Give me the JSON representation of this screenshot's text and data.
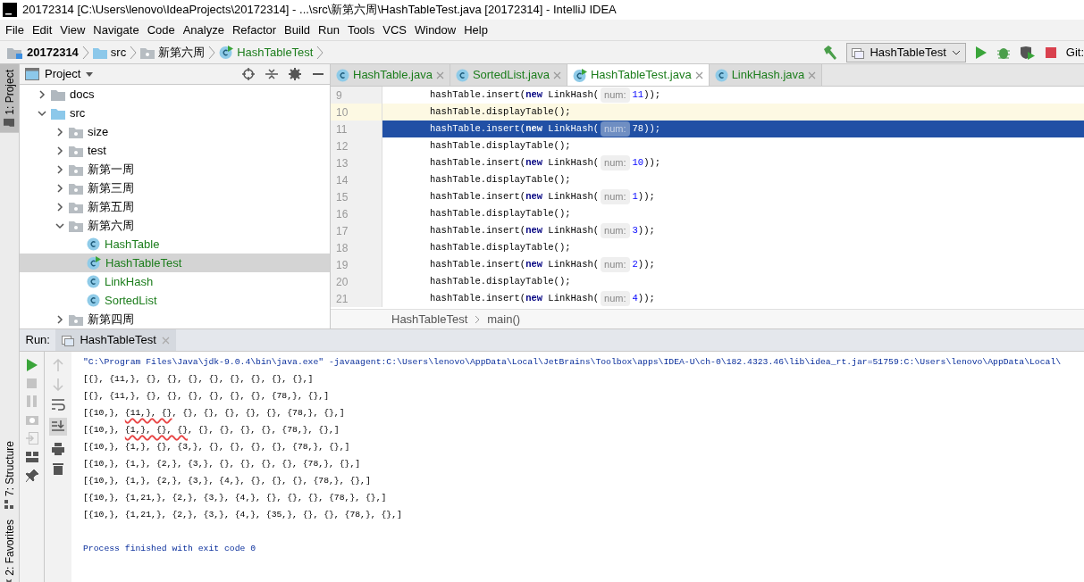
{
  "window": {
    "title": "20172314 [C:\\Users\\lenovo\\IdeaProjects\\20172314] - ...\\src\\新第六周\\HashTableTest.java [20172314] - IntelliJ IDEA"
  },
  "menu": [
    "File",
    "Edit",
    "View",
    "Navigate",
    "Code",
    "Analyze",
    "Refactor",
    "Build",
    "Run",
    "Tools",
    "VCS",
    "Window",
    "Help"
  ],
  "breadcrumbs": [
    {
      "label": "20172314",
      "kind": "project"
    },
    {
      "label": "src",
      "kind": "source_root"
    },
    {
      "label": "新第六周",
      "kind": "package"
    },
    {
      "label": "HashTableTest",
      "kind": "main_class"
    }
  ],
  "toolbar": {
    "run_config": "HashTableTest",
    "vcs_label": "Git:"
  },
  "side_tools": [
    {
      "label": "1: Project",
      "selected": true
    },
    {
      "label": "7: Structure",
      "selected": false
    },
    {
      "label": "2: Favorites",
      "selected": false
    }
  ],
  "project_panel": {
    "title": "Project",
    "tree": [
      {
        "label": "docs",
        "kind": "folder",
        "expanded": false,
        "selected": false
      },
      {
        "label": "src",
        "kind": "source_root",
        "expanded": true,
        "selected": false,
        "children": [
          {
            "label": "size",
            "kind": "package",
            "expanded": false,
            "selected": false
          },
          {
            "label": "test",
            "kind": "package",
            "expanded": false,
            "selected": false
          },
          {
            "label": "新第一周",
            "kind": "package",
            "expanded": false,
            "selected": false
          },
          {
            "label": "新第三周",
            "kind": "package",
            "expanded": false,
            "selected": false
          },
          {
            "label": "新第五周",
            "kind": "package",
            "expanded": false,
            "selected": false
          },
          {
            "label": "新第六周",
            "kind": "package",
            "expanded": true,
            "selected": false,
            "children": [
              {
                "label": "HashTable",
                "kind": "class",
                "selected": false
              },
              {
                "label": "HashTableTest",
                "kind": "main_class",
                "selected": true
              },
              {
                "label": "LinkHash",
                "kind": "class",
                "selected": false
              },
              {
                "label": "SortedList",
                "kind": "class",
                "selected": false
              }
            ]
          },
          {
            "label": "新第四周",
            "kind": "package",
            "expanded": false,
            "selected": false
          }
        ]
      }
    ]
  },
  "editor_tabs": [
    {
      "label": "HashTable.java",
      "kind": "class",
      "selected": false
    },
    {
      "label": "SortedList.java",
      "kind": "class",
      "selected": false
    },
    {
      "label": "HashTableTest.java",
      "kind": "main_class",
      "selected": true
    },
    {
      "label": "LinkHash.java",
      "kind": "class",
      "selected": false
    }
  ],
  "code_lines": [
    {
      "number": "9",
      "caret": false,
      "selected": false,
      "tokens": [
        {
          "kind": "plain",
          "text": "hashTable.insert("
        },
        {
          "kind": "keyword",
          "text": "new"
        },
        {
          "kind": "plain",
          "text": " LinkHash("
        },
        {
          "kind": "hint",
          "text": "num:"
        },
        {
          "kind": "number",
          "text": "11"
        },
        {
          "kind": "plain",
          "text": "));"
        }
      ]
    },
    {
      "number": "10",
      "caret": true,
      "selected": false,
      "tokens": [
        {
          "kind": "plain",
          "text": "hashTable.displayTable();"
        }
      ]
    },
    {
      "number": "11",
      "caret": false,
      "selected": true,
      "tokens": [
        {
          "kind": "plain",
          "text": "hashTable.insert("
        },
        {
          "kind": "keyword",
          "text": "new"
        },
        {
          "kind": "plain",
          "text": " LinkHash("
        },
        {
          "kind": "hint",
          "text": "num:"
        },
        {
          "kind": "number",
          "text": "78"
        },
        {
          "kind": "plain",
          "text": "));"
        }
      ]
    },
    {
      "number": "12",
      "caret": false,
      "selected": false,
      "tokens": [
        {
          "kind": "plain",
          "text": "hashTable.displayTable();"
        }
      ]
    },
    {
      "number": "13",
      "caret": false,
      "selected": false,
      "tokens": [
        {
          "kind": "plain",
          "text": "hashTable.insert("
        },
        {
          "kind": "keyword",
          "text": "new"
        },
        {
          "kind": "plain",
          "text": " LinkHash("
        },
        {
          "kind": "hint",
          "text": "num:"
        },
        {
          "kind": "number",
          "text": "10"
        },
        {
          "kind": "plain",
          "text": "));"
        }
      ]
    },
    {
      "number": "14",
      "caret": false,
      "selected": false,
      "tokens": [
        {
          "kind": "plain",
          "text": "hashTable.displayTable();"
        }
      ]
    },
    {
      "number": "15",
      "caret": false,
      "selected": false,
      "tokens": [
        {
          "kind": "plain",
          "text": "hashTable.insert("
        },
        {
          "kind": "keyword",
          "text": "new"
        },
        {
          "kind": "plain",
          "text": " LinkHash("
        },
        {
          "kind": "hint",
          "text": "num:"
        },
        {
          "kind": "number",
          "text": "1"
        },
        {
          "kind": "plain",
          "text": "));"
        }
      ]
    },
    {
      "number": "16",
      "caret": false,
      "selected": false,
      "tokens": [
        {
          "kind": "plain",
          "text": "hashTable.displayTable();"
        }
      ]
    },
    {
      "number": "17",
      "caret": false,
      "selected": false,
      "tokens": [
        {
          "kind": "plain",
          "text": "hashTable.insert("
        },
        {
          "kind": "keyword",
          "text": "new"
        },
        {
          "kind": "plain",
          "text": " LinkHash("
        },
        {
          "kind": "hint",
          "text": "num:"
        },
        {
          "kind": "number",
          "text": "3"
        },
        {
          "kind": "plain",
          "text": "));"
        }
      ]
    },
    {
      "number": "18",
      "caret": false,
      "selected": false,
      "tokens": [
        {
          "kind": "plain",
          "text": "hashTable.displayTable();"
        }
      ]
    },
    {
      "number": "19",
      "caret": false,
      "selected": false,
      "tokens": [
        {
          "kind": "plain",
          "text": "hashTable.insert("
        },
        {
          "kind": "keyword",
          "text": "new"
        },
        {
          "kind": "plain",
          "text": " LinkHash("
        },
        {
          "kind": "hint",
          "text": "num:"
        },
        {
          "kind": "number",
          "text": "2"
        },
        {
          "kind": "plain",
          "text": "));"
        }
      ]
    },
    {
      "number": "20",
      "caret": false,
      "selected": false,
      "tokens": [
        {
          "kind": "plain",
          "text": "hashTable.displayTable();"
        }
      ]
    },
    {
      "number": "21",
      "caret": false,
      "selected": false,
      "tokens": [
        {
          "kind": "plain",
          "text": "hashTable.insert("
        },
        {
          "kind": "keyword",
          "text": "new"
        },
        {
          "kind": "plain",
          "text": " LinkHash("
        },
        {
          "kind": "hint",
          "text": "num:"
        },
        {
          "kind": "number",
          "text": "4"
        },
        {
          "kind": "plain",
          "text": "));"
        }
      ]
    }
  ],
  "editor_breadcrumbs": [
    "HashTableTest",
    "main()"
  ],
  "run_panel": {
    "label": "Run:",
    "tab": "HashTableTest",
    "console": [
      {
        "kind": "command",
        "segments": [
          {
            "text": "\"C:\\Program Files\\Java\\jdk-9.0.4\\bin\\java.exe\" -javaagent:C:\\Users\\lenovo\\AppData\\Local\\JetBrains\\Toolbox\\apps\\IDEA-U\\ch-0\\182.4323.46\\lib\\idea_rt.jar=51759:C:\\Users\\lenovo\\AppData\\Local\\",
            "underlined": false
          }
        ]
      },
      {
        "kind": "output",
        "segments": [
          {
            "text": "[{}, {11,}, {}, {}, {}, {}, {}, {}, {}, {},]",
            "underlined": false
          }
        ]
      },
      {
        "kind": "output",
        "segments": [
          {
            "text": "[{}, {11,}, {}, {}, {}, {}, {}, {}, {78,}, {},]",
            "underlined": false
          }
        ]
      },
      {
        "kind": "output",
        "segments": [
          {
            "text": "[{10,}, ",
            "underlined": false
          },
          {
            "text": "{11,}, {}",
            "underlined": true
          },
          {
            "text": ", {}, {}, {}, {}, {}, {78,}, {},]",
            "underlined": false
          }
        ]
      },
      {
        "kind": "output",
        "segments": [
          {
            "text": "[{10,}, ",
            "underlined": false
          },
          {
            "text": "{1,}, {}, {}",
            "underlined": true
          },
          {
            "text": ", {}, {}, {}, {}, {78,}, {},]",
            "underlined": false
          }
        ]
      },
      {
        "kind": "output",
        "segments": [
          {
            "text": "[{10,}, {1,}, {}, {3,}, {}, {}, {}, {}, {78,}, {},]",
            "underlined": false
          }
        ]
      },
      {
        "kind": "output",
        "segments": [
          {
            "text": "[{10,}, {1,}, {2,}, {3,}, {}, {}, {}, {}, {78,}, {},]",
            "underlined": false
          }
        ]
      },
      {
        "kind": "output",
        "segments": [
          {
            "text": "[{10,}, {1,}, {2,}, {3,}, {4,}, {}, {}, {}, {78,}, {},]",
            "underlined": false
          }
        ]
      },
      {
        "kind": "output",
        "segments": [
          {
            "text": "[{10,}, {1,21,}, {2,}, {3,}, {4,}, {}, {}, {}, {78,}, {},]",
            "underlined": false
          }
        ]
      },
      {
        "kind": "output",
        "segments": [
          {
            "text": "[{10,}, {1,21,}, {2,}, {3,}, {4,}, {35,}, {}, {}, {78,}, {},]",
            "underlined": false
          }
        ]
      },
      {
        "kind": "blank"
      },
      {
        "kind": "exit",
        "segments": [
          {
            "text": "Process finished with exit code 0",
            "underlined": false
          }
        ]
      }
    ]
  }
}
